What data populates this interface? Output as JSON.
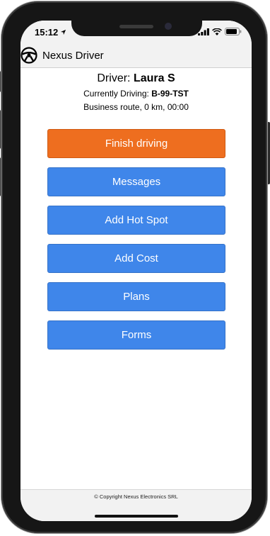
{
  "status_bar": {
    "time": "15:12"
  },
  "app": {
    "title": "Nexus Driver"
  },
  "driver": {
    "prefix": "Driver:",
    "name": "Laura S",
    "driving_prefix": "Currently Driving:",
    "plate": "B-99-TST",
    "route_info": "Business route, 0 km, 00:00"
  },
  "buttons": {
    "finish": "Finish driving",
    "messages": "Messages",
    "hotspot": "Add Hot Spot",
    "cost": "Add Cost",
    "plans": "Plans",
    "forms": "Forms"
  },
  "footer": {
    "copyright": "© Copyright Nexus Electronics SRL"
  },
  "colors": {
    "primary_button": "#3f86ea",
    "finish_button": "#ee6e1f",
    "header_bg": "#f2f2f2"
  }
}
